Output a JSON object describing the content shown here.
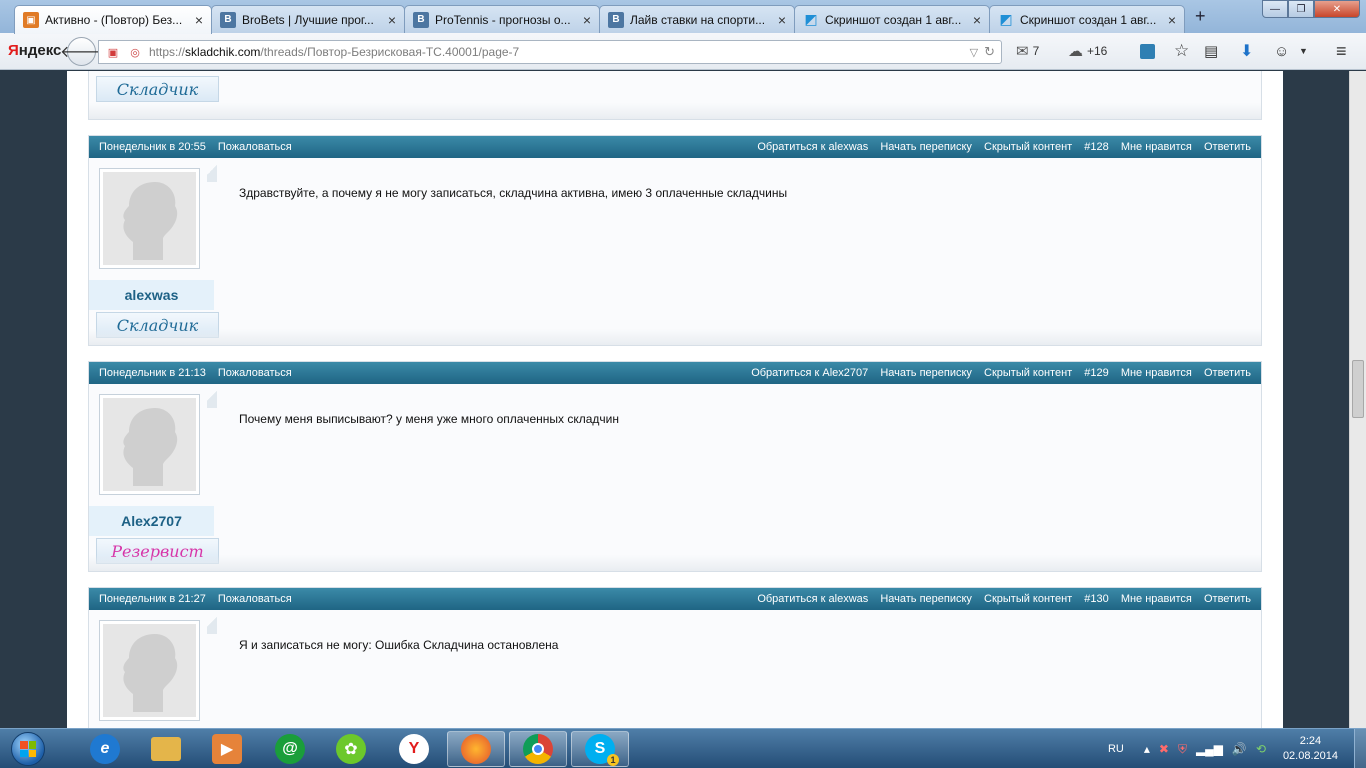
{
  "browser": {
    "tabs": [
      {
        "title": "Активно - (Повтор) Без...",
        "favicon": "box-icon",
        "active": true
      },
      {
        "title": "BroBets | Лучшие прог...",
        "favicon": "vk-icon",
        "active": false
      },
      {
        "title": "ProTennis - прогнозы о...",
        "favicon": "vk-icon",
        "active": false
      },
      {
        "title": "Лайв ставки на спорти...",
        "favicon": "vk-icon",
        "active": false
      },
      {
        "title": "Скриншот создан 1 авг...",
        "favicon": "screenshot-icon",
        "active": false
      },
      {
        "title": "Скриншот создан 1 авг...",
        "favicon": "screenshot-icon",
        "active": false
      }
    ],
    "tab_close": "×",
    "new_tab": "+",
    "window": {
      "minimize": "—",
      "maximize": "❐",
      "close": "✕"
    },
    "logo": {
      "first": "Я",
      "rest": "ндекс"
    },
    "url": {
      "prefix": "https://",
      "host": "skladchik.com",
      "path": "/threads/Повтор-Безрисковая-ТС.40001/page-7"
    },
    "toolbar": {
      "mail_count": "7",
      "weather": "+16"
    }
  },
  "thread": {
    "prev_rank": "Складчик",
    "posts": [
      {
        "time": "Понедельник в 20:55",
        "report": "Пожаловаться",
        "reply_to": "Обратиться к alexwas",
        "start_convo": "Начать переписку",
        "hidden": "Скрытый контент",
        "number": "#128",
        "like": "Мне нравится",
        "reply": "Ответить",
        "username": "alexwas",
        "rank": "Складчик",
        "message": "Здравствуйте, а почему я не могу записаться, складчина активна, имею 3 оплаченные складчины"
      },
      {
        "time": "Понедельник в 21:13",
        "report": "Пожаловаться",
        "reply_to": "Обратиться к Alex2707",
        "start_convo": "Начать переписку",
        "hidden": "Скрытый контент",
        "number": "#129",
        "like": "Мне нравится",
        "reply": "Ответить",
        "username": "Alex2707",
        "rank": "Резервист",
        "message": "Почему меня выписывают? у меня уже много оплаченных складчин"
      },
      {
        "time": "Понедельник в 21:27",
        "report": "Пожаловаться",
        "reply_to": "Обратиться к alexwas",
        "start_convo": "Начать переписку",
        "hidden": "Скрытый контент",
        "number": "#130",
        "like": "Мне нравится",
        "reply": "Ответить",
        "message": "Я и записаться не могу: Ошибка Складчина остановлена"
      }
    ]
  },
  "taskbar": {
    "apps": [
      "internet-explorer",
      "file-explorer",
      "media-player",
      "mail-agent",
      "icq",
      "yandex-browser",
      "firefox",
      "chrome",
      "skype"
    ],
    "skype_badge": "1",
    "lang": "RU",
    "time": "2:24",
    "date": "02.08.2014"
  },
  "colors": {
    "post_bar": "#2a7596",
    "username": "#1d6185",
    "rank_reserve": "#d634a8"
  }
}
